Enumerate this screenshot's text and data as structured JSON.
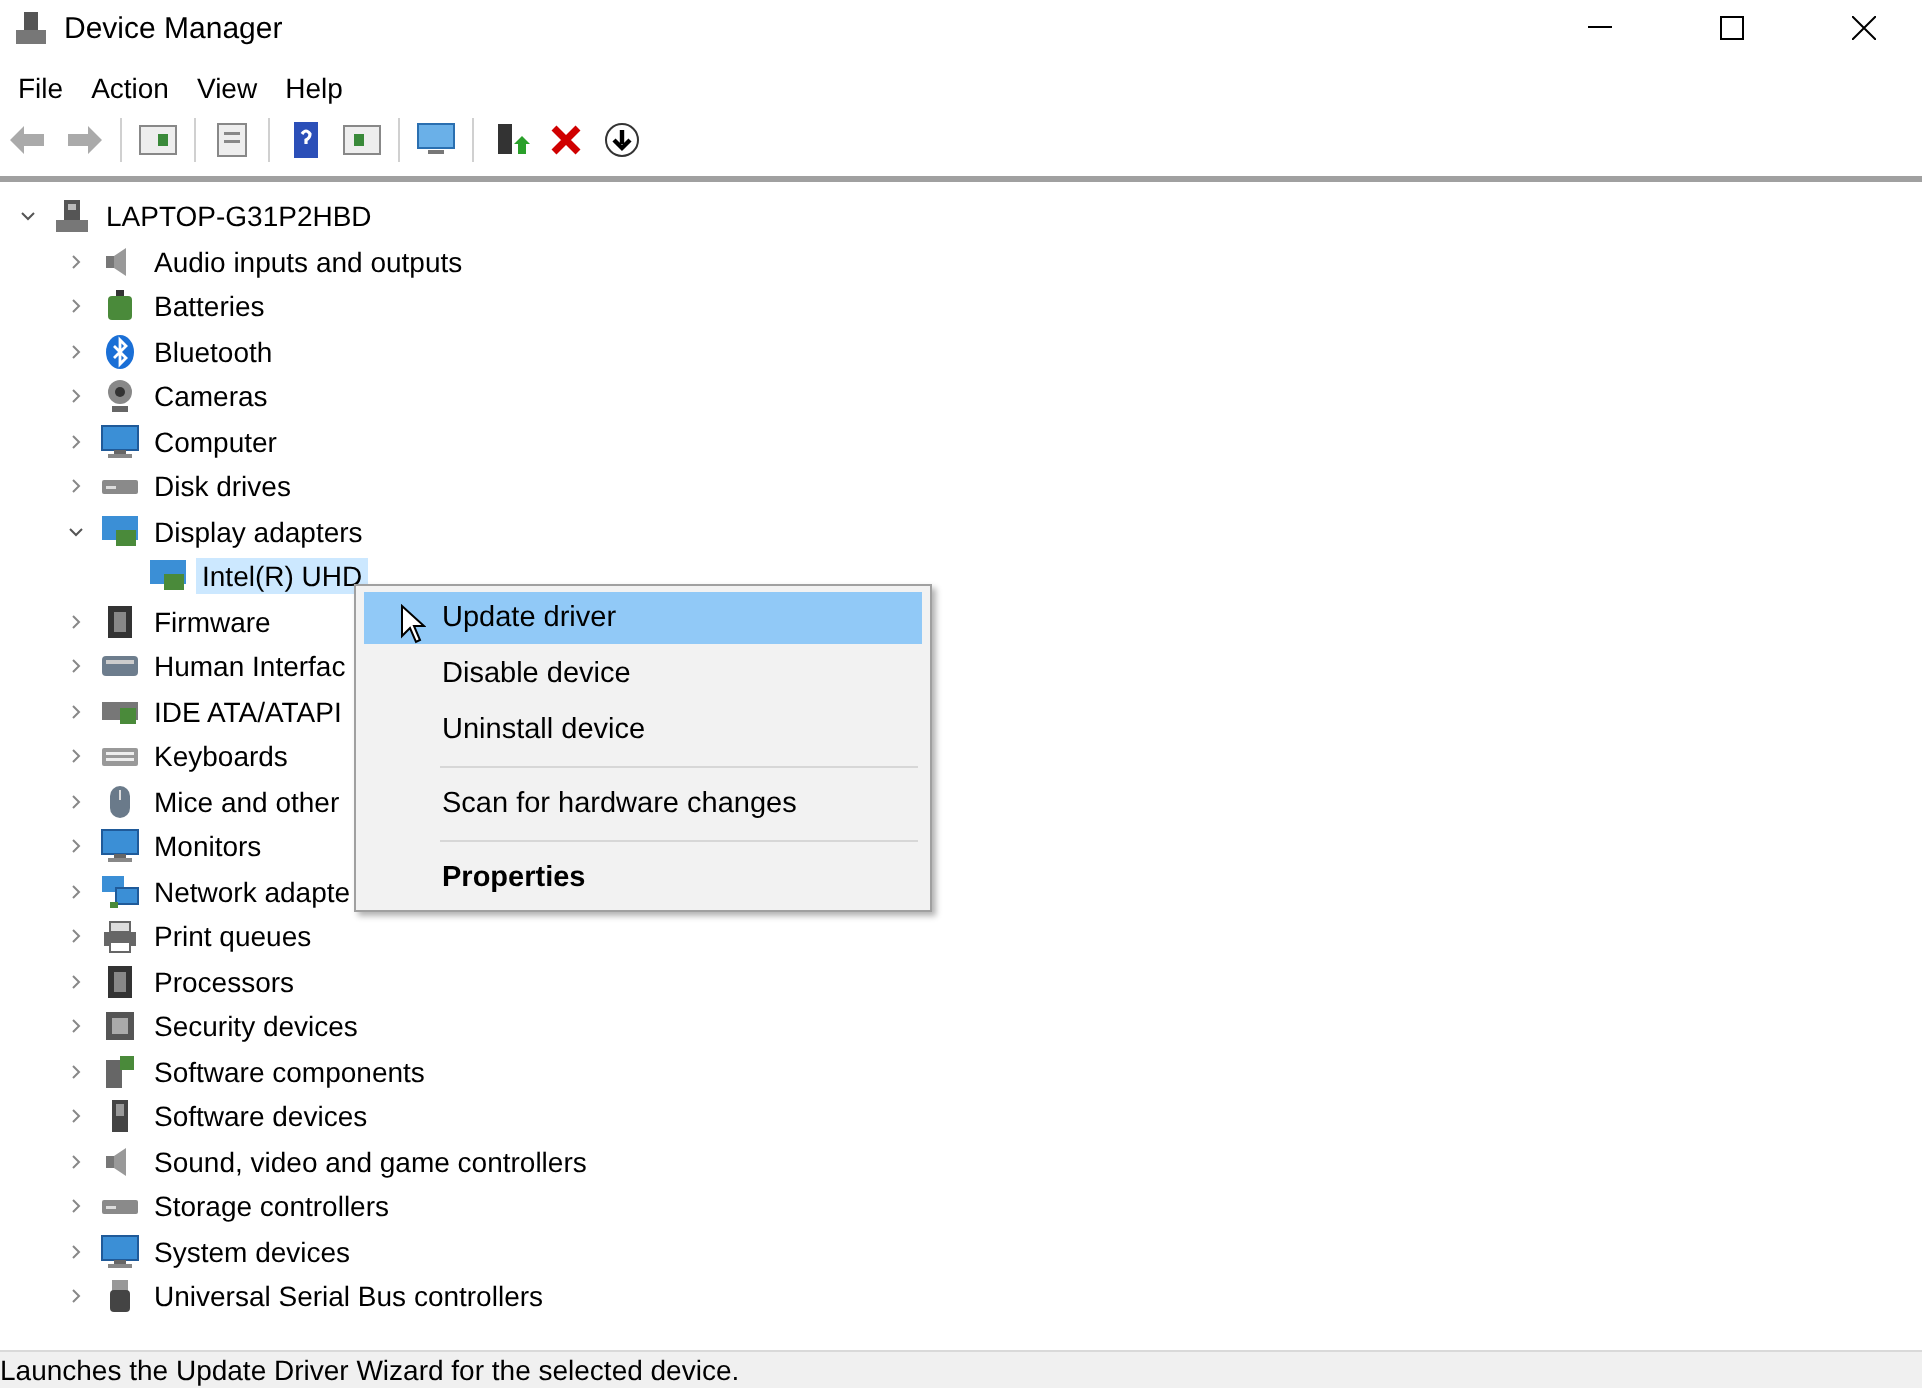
{
  "window": {
    "title": "Device Manager"
  },
  "menu_bar": [
    "File",
    "Action",
    "View",
    "Help"
  ],
  "tree": {
    "label": "LAPTOP-G31P2HBD",
    "expanded": true,
    "selected": false,
    "children": [
      {
        "label": "Audio inputs and outputs",
        "expanded": false,
        "selected": false
      },
      {
        "label": "Batteries",
        "expanded": false,
        "selected": false
      },
      {
        "label": "Bluetooth",
        "expanded": false,
        "selected": false
      },
      {
        "label": "Cameras",
        "expanded": false,
        "selected": false
      },
      {
        "label": "Computer",
        "expanded": false,
        "selected": false
      },
      {
        "label": "Disk drives",
        "expanded": false,
        "selected": false
      },
      {
        "label": "Display adapters",
        "expanded": true,
        "selected": false,
        "children": [
          {
            "label": "Intel(R) UHD",
            "selected": true
          }
        ]
      },
      {
        "label": "Firmware",
        "expanded": false,
        "selected": false
      },
      {
        "label": "Human Interfac",
        "expanded": false,
        "selected": false
      },
      {
        "label": "IDE ATA/ATAPI",
        "expanded": false,
        "selected": false
      },
      {
        "label": "Keyboards",
        "expanded": false,
        "selected": false
      },
      {
        "label": "Mice and other",
        "expanded": false,
        "selected": false
      },
      {
        "label": "Monitors",
        "expanded": false,
        "selected": false
      },
      {
        "label": "Network adapte",
        "expanded": false,
        "selected": false
      },
      {
        "label": "Print queues",
        "expanded": false,
        "selected": false
      },
      {
        "label": "Processors",
        "expanded": false,
        "selected": false
      },
      {
        "label": "Security devices",
        "expanded": false,
        "selected": false
      },
      {
        "label": "Software components",
        "expanded": false,
        "selected": false
      },
      {
        "label": "Software devices",
        "expanded": false,
        "selected": false
      },
      {
        "label": "Sound, video and game controllers",
        "expanded": false,
        "selected": false
      },
      {
        "label": "Storage controllers",
        "expanded": false,
        "selected": false
      },
      {
        "label": "System devices",
        "expanded": false,
        "selected": false
      },
      {
        "label": "Universal Serial Bus controllers",
        "expanded": false,
        "selected": false
      }
    ]
  },
  "context_menu": [
    {
      "kind": "item",
      "label": "Update driver",
      "selected": true
    },
    {
      "kind": "item",
      "label": "Disable device",
      "selected": false
    },
    {
      "kind": "item",
      "label": "Uninstall device",
      "selected": false
    },
    {
      "kind": "separator"
    },
    {
      "kind": "item",
      "label": "Scan for hardware changes",
      "selected": false
    },
    {
      "kind": "separator"
    },
    {
      "kind": "default",
      "label": "Properties",
      "selected": false
    }
  ],
  "status_bar": "Launches the Update Driver Wizard for the selected device."
}
